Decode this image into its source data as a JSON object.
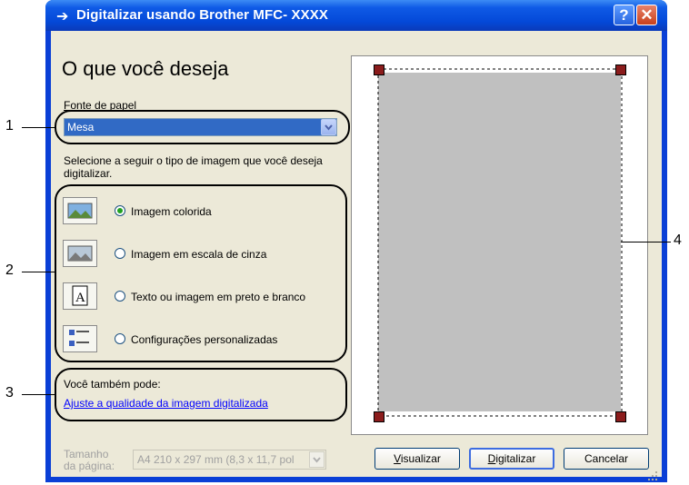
{
  "window": {
    "title": "Digitalizar usando Brother MFC- XXXX",
    "help_glyph": "?",
    "close_glyph": "✕"
  },
  "main": {
    "heading": "O que você deseja",
    "source_label": "Fonte de papel",
    "source_value": "Mesa",
    "instruction": "Selecione a seguir o tipo de imagem que você deseja digitalizar.",
    "options": [
      {
        "label": "Imagem colorida",
        "selected": true
      },
      {
        "label": "Imagem em escala de cinza",
        "selected": false
      },
      {
        "label": "Texto ou imagem em preto e branco",
        "selected": false
      },
      {
        "label": "Configurações personalizadas",
        "selected": false
      }
    ],
    "also_label": "Você também pode:",
    "adjust_link": "Ajuste a qualidade da imagem digitalizada",
    "page_size_label_1": "Tamanho",
    "page_size_label_2": "da página:",
    "page_size_value": "A4 210 x 297 mm (8,3 x 11,7 pol"
  },
  "buttons": {
    "preview": "Visualizar",
    "scan": "Digitalizar",
    "cancel": "Cancelar"
  },
  "callouts": [
    "1",
    "2",
    "3",
    "4"
  ],
  "colors": {
    "titlebar": "#0449d8",
    "dialog_bg": "#ece9d8",
    "selection": "#316ac5",
    "link": "#0000ff",
    "crop_handle": "#8b1c1c"
  }
}
